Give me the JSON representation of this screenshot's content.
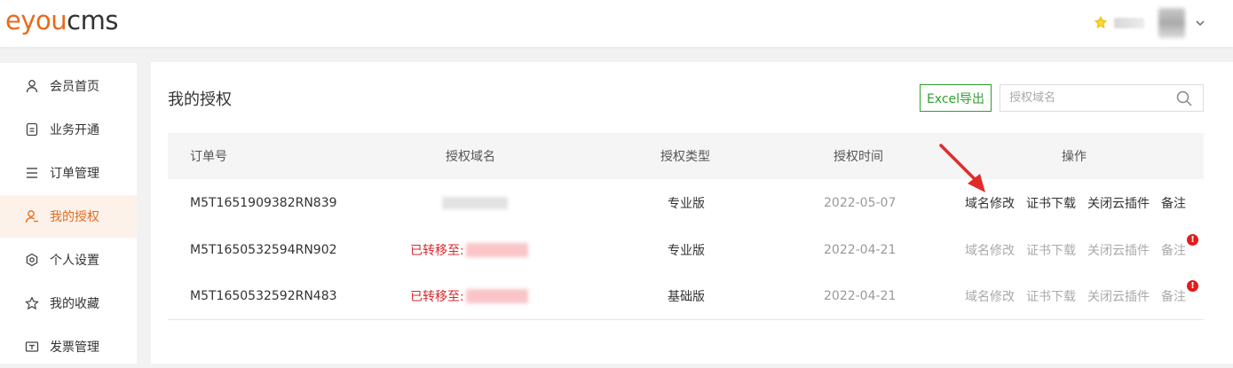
{
  "brand": {
    "logo_e": "e",
    "logo_you": "you",
    "logo_cms": "cms"
  },
  "sidebar": {
    "items": [
      {
        "label": "会员首页",
        "icon": "user-icon"
      },
      {
        "label": "业务开通",
        "icon": "service-icon"
      },
      {
        "label": "订单管理",
        "icon": "list-icon"
      },
      {
        "label": "我的授权",
        "icon": "license-user-icon",
        "active": true
      },
      {
        "label": "个人设置",
        "icon": "settings-icon"
      },
      {
        "label": "我的收藏",
        "icon": "star-icon"
      },
      {
        "label": "发票管理",
        "icon": "invoice-icon"
      }
    ]
  },
  "main": {
    "title": "我的授权",
    "excel_label": "Excel导出",
    "search_placeholder": "授权域名",
    "columns": [
      "订单号",
      "授权域名",
      "授权类型",
      "授权时间",
      "操作"
    ],
    "rows": [
      {
        "order": "M5T1651909382RN839",
        "domain_prefix": "",
        "type": "专业版",
        "time": "2022-05-07",
        "ops_enabled": true,
        "alert": false
      },
      {
        "order": "M5T1650532594RN902",
        "domain_prefix": "已转移至:",
        "type": "专业版",
        "time": "2022-04-21",
        "ops_enabled": false,
        "alert": true
      },
      {
        "order": "M5T1650532592RN483",
        "domain_prefix": "已转移至:",
        "type": "基础版",
        "time": "2022-04-21",
        "ops_enabled": false,
        "alert": true
      }
    ],
    "ops": [
      "域名修改",
      "证书下载",
      "关闭云插件",
      "备注"
    ]
  },
  "colors": {
    "accent": "#e86a1c",
    "excel_green": "#2e9f2e",
    "transfer_red": "#d8282f",
    "arrow_red": "#e02b2b"
  }
}
